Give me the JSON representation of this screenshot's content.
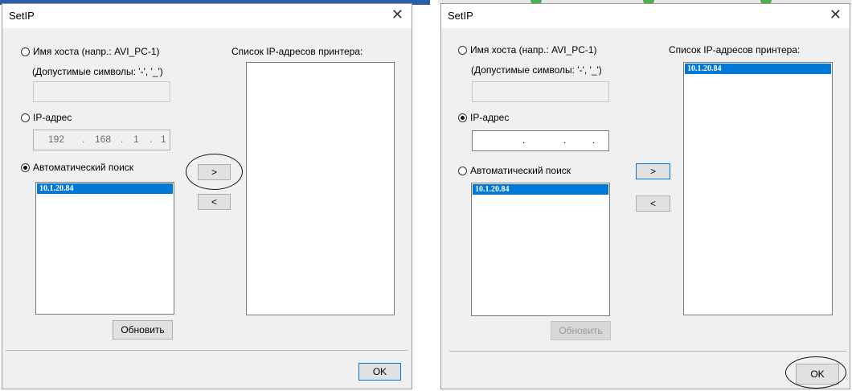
{
  "left_dialog": {
    "title": "SetIP",
    "close_glyph": "✕",
    "hostname_radio_label": "Имя хоста (напр.: AVI_PC-1)",
    "hostname_hint": "(Допустимые символы: '-', '_')",
    "hostname_value": "",
    "ip_radio_label": "IP-адрес",
    "ip_octets": [
      "192",
      "168",
      "1",
      "1"
    ],
    "auto_radio_label": "Автоматический поиск",
    "selected_radio": "auto",
    "found_list": [
      "10.1.20.84"
    ],
    "add_button": ">",
    "remove_button": "<",
    "refresh_button": "Обновить",
    "printer_list_label": "Список IP-адресов принтера:",
    "printer_list": [],
    "ok_button": "OK"
  },
  "right_dialog": {
    "title": "SetIP",
    "close_glyph": "✕",
    "hostname_radio_label": "Имя хоста (напр.: AVI_PC-1)",
    "hostname_hint": "(Допустимые символы: '-', '_')",
    "hostname_value": "",
    "ip_radio_label": "IP-адрес",
    "ip_octets": [
      "",
      "",
      "",
      ""
    ],
    "auto_radio_label": "Автоматический поиск",
    "selected_radio": "ip",
    "found_list": [
      "10.1.20.84"
    ],
    "add_button": ">",
    "remove_button": "<",
    "refresh_button": "Обновить",
    "printer_list_label": "Список IP-адресов принтера:",
    "printer_list": [
      "10.1.20.84"
    ],
    "ok_button": "OK"
  },
  "colors": {
    "selection": "#0078d7",
    "dialog_bg": "#f0f0f0",
    "top_strip_blue": "#2b5fa8",
    "top_marker_green": "#4caf50"
  }
}
